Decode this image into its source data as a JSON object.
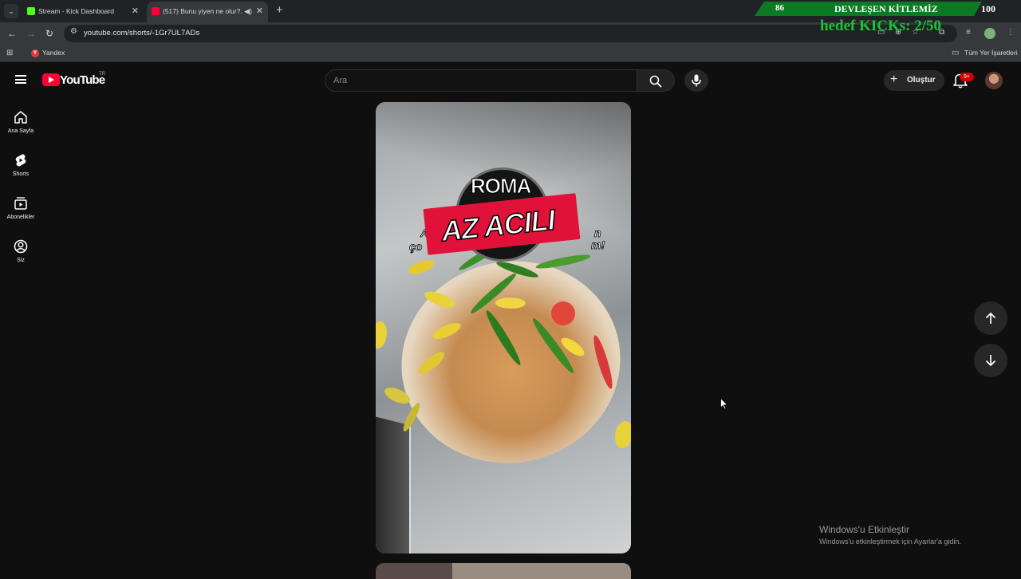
{
  "browser": {
    "tabs": [
      {
        "title": "Stream - Kick Dashboard",
        "favicon_color": "#53fc18",
        "active": false
      },
      {
        "title": "(517) Bunu yiyen ne olur?..",
        "favicon_color": "#ff0033",
        "active": true
      }
    ],
    "new_tab_glyph": "+",
    "url": "youtube.com/shorts/-1Gr7UL7ADs",
    "bookmarks": [
      {
        "label": "Yandex",
        "icon": "yandex-icon"
      }
    ],
    "all_bookmarks_label": "Tüm Yer İşaretleri"
  },
  "stream_overlay": {
    "current": "86",
    "goal_title": "DEVLEŞEN KİTLEMİZ",
    "target": "100",
    "subtitle": "hedef KICKs: 2/50"
  },
  "youtube": {
    "logo_text": "YouTube",
    "country_code": "TR",
    "search_placeholder": "Ara",
    "create_label": "Oluştur",
    "notification_badge": "9+",
    "guide": [
      {
        "label": "Ana Sayfa",
        "icon": "home-icon"
      },
      {
        "label": "Shorts",
        "icon": "shorts-icon"
      },
      {
        "label": "Abonelikler",
        "icon": "subscriptions-icon"
      },
      {
        "label": "Siz",
        "icon": "you-icon"
      }
    ]
  },
  "short": {
    "overlay_brand": "ROMA",
    "overlay_banner": "AZ ACILI",
    "overlay_caption_left": "A",
    "overlay_caption_right": "n",
    "overlay_caption_line2_left": "ço",
    "overlay_caption_line2_right": "m!"
  },
  "colors": {
    "yt_red": "#ff0033",
    "kick_green": "#0c7a22",
    "kick_text_green": "#17c536",
    "banner_red": "#e0123a"
  },
  "windows_activation": {
    "title": "Windows'u Etkinleştir",
    "subtitle": "Windows'u etkinleştirmek için Ayarlar'a gidin."
  }
}
